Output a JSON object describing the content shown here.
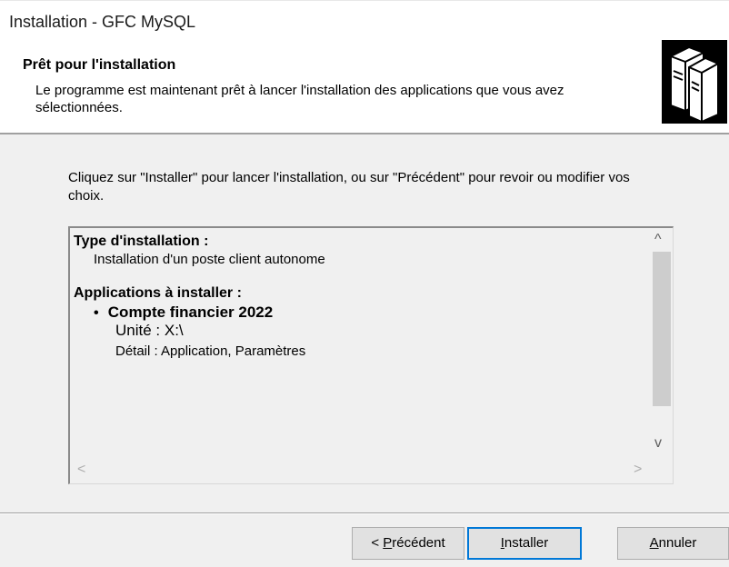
{
  "window": {
    "title": "Installation - GFC MySQL"
  },
  "header": {
    "heading": "Prêt pour l'installation",
    "subtitle": "Le programme est maintenant prêt à lancer l'installation des applications que vous avez sélectionnées."
  },
  "body": {
    "intro": "Cliquez sur \"Installer\" pour lancer l'installation, ou sur \"Précédent\" pour revoir ou modifier vos choix.",
    "memo": {
      "type_label": "Type d'installation :",
      "type_value": "Installation d'un poste client autonome",
      "apps_label": "Applications à installer :",
      "bullet": "•",
      "app_name": "Compte financier 2022",
      "unit": "Unité : X:\\",
      "detail": "Détail : Application, Paramètres"
    },
    "scroll": {
      "up": "^",
      "down": "v",
      "left": "<",
      "right": ">"
    }
  },
  "buttons": {
    "back": {
      "prefix": "< ",
      "accel": "P",
      "rest": "récédent"
    },
    "install": {
      "accel": "I",
      "rest": "nstaller"
    },
    "cancel": {
      "accel": "A",
      "rest": "nnuler"
    }
  },
  "icons": {
    "logo": "server-computers-icon"
  }
}
